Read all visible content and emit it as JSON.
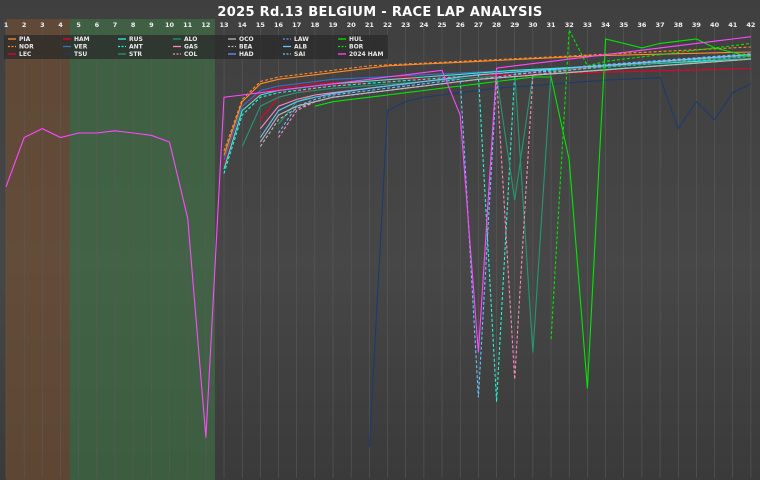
{
  "chart_data": {
    "type": "line",
    "title": "2025 Rd.13 BELGIUM - RACE LAP ANALYSIS",
    "xlabel": "",
    "ylabel": "",
    "x": [
      1,
      2,
      3,
      4,
      5,
      6,
      7,
      8,
      9,
      10,
      11,
      12,
      13,
      14,
      15,
      16,
      17,
      18,
      19,
      20,
      21,
      22,
      23,
      24,
      25,
      26,
      27,
      28,
      29,
      30,
      31,
      32,
      33,
      34,
      35,
      36,
      37,
      38,
      39,
      40,
      41,
      42
    ],
    "xlim": [
      1,
      42.5
    ],
    "ylim": [
      0,
      100
    ],
    "grid": true,
    "legend_position": "top-left",
    "shaded_regions": [
      {
        "from": 1,
        "to": 4.5,
        "color": "#7a5030"
      },
      {
        "from": 4.5,
        "to": 12.5,
        "color": "#3e7a45"
      }
    ],
    "series": [
      {
        "name": "PIA",
        "color": "#ff8a2a",
        "dash": false,
        "values": [
          null,
          null,
          null,
          null,
          null,
          null,
          null,
          null,
          null,
          null,
          null,
          null,
          72,
          84,
          88,
          89,
          89.5,
          90,
          90.5,
          91,
          91.5,
          92,
          92.2,
          92.4,
          92.6,
          92.8,
          93,
          93.2,
          93.4,
          93.6,
          93.8,
          94,
          94.2,
          94.3,
          94.4,
          94.5,
          94.6,
          94.7,
          94.8,
          94.9,
          95,
          95.1
        ]
      },
      {
        "name": "NOR",
        "color": "#ff8a2a",
        "dash": true,
        "values": [
          null,
          null,
          null,
          null,
          null,
          null,
          null,
          null,
          null,
          null,
          null,
          null,
          73,
          84.5,
          88.5,
          89.5,
          90,
          90.5,
          91,
          91.5,
          92,
          92.2,
          92.4,
          92.6,
          92.8,
          93,
          93.2,
          93.4,
          93.6,
          93.8,
          94,
          94.2,
          94.4,
          94.6,
          94.8,
          95,
          95.2,
          95.4,
          95.6,
          95.8,
          96,
          96.2
        ]
      },
      {
        "name": "LEC",
        "color": "#e8002d",
        "dash": false,
        "values": [
          null,
          null,
          null,
          null,
          null,
          null,
          null,
          null,
          null,
          null,
          null,
          null,
          70,
          82,
          86,
          87,
          87.5,
          88,
          88.2,
          88.4,
          88.6,
          88.8,
          89,
          89.2,
          89.4,
          89.6,
          89.8,
          90,
          90.1,
          90.2,
          90.3,
          90.4,
          90.5,
          90.6,
          90.7,
          90.8,
          90.9,
          91,
          91.1,
          91.2,
          91.3,
          91.4
        ]
      },
      {
        "name": "HAM",
        "color": "#e8002d",
        "dash": false,
        "values": [
          null,
          null,
          null,
          null,
          null,
          null,
          null,
          null,
          null,
          null,
          null,
          null,
          null,
          null,
          80,
          85,
          86,
          87,
          87.5,
          88,
          88.5,
          89,
          89.5,
          90,
          90.2,
          90.4,
          90.6,
          90.8,
          91,
          91.2,
          91.4,
          91.6,
          91.8,
          92,
          92.2,
          92.4,
          92.6,
          92.8,
          93,
          93.2,
          93.4,
          93.6
        ]
      },
      {
        "name": "VER",
        "color": "#3671c6",
        "dash": false,
        "values": [
          null,
          null,
          null,
          null,
          null,
          null,
          null,
          null,
          null,
          null,
          null,
          null,
          71,
          83,
          86.5,
          87.5,
          88,
          88.5,
          89,
          89.2,
          89.4,
          89.6,
          89.8,
          90,
          90.2,
          90.4,
          90.6,
          90.8,
          91,
          91.2,
          91.4,
          91.6,
          91.8,
          92,
          92.2,
          92.4,
          92.6,
          92.8,
          93,
          93.2,
          93.4,
          93.6
        ]
      },
      {
        "name": "TSU",
        "color": "#1b3b70",
        "dash": false,
        "values": [
          null,
          null,
          null,
          null,
          null,
          null,
          null,
          null,
          null,
          null,
          null,
          null,
          null,
          null,
          null,
          null,
          null,
          null,
          null,
          null,
          7,
          82,
          84,
          85,
          85.5,
          86,
          86.5,
          87,
          87.3,
          87.6,
          87.9,
          88.2,
          88.5,
          88.8,
          89,
          89.2,
          89.4,
          78,
          84,
          80,
          86,
          88
        ]
      },
      {
        "name": "RUS",
        "color": "#27f4d2",
        "dash": false,
        "values": [
          null,
          null,
          null,
          null,
          null,
          null,
          null,
          null,
          null,
          null,
          null,
          null,
          69,
          82,
          85.5,
          86.5,
          87,
          87.5,
          88,
          88.3,
          88.6,
          88.9,
          89.2,
          89.5,
          89.8,
          90.1,
          90.4,
          90.7,
          91,
          91.2,
          91.4,
          91.6,
          91.8,
          92,
          92.2,
          92.4,
          92.6,
          92.8,
          93,
          93.2,
          93.4,
          93.6
        ]
      },
      {
        "name": "ANT",
        "color": "#27f4d2",
        "dash": true,
        "values": [
          null,
          null,
          null,
          null,
          null,
          null,
          null,
          null,
          null,
          null,
          null,
          null,
          68,
          81,
          85,
          86,
          86.5,
          87,
          87.5,
          87.8,
          88.1,
          88.4,
          88.7,
          89,
          89.3,
          89.6,
          89.9,
          17,
          90.2,
          90.5,
          90.8,
          91.1,
          91.4,
          91.7,
          92,
          92.3,
          92.6,
          92.9,
          93.2,
          93.5,
          93.8,
          94.1
        ]
      },
      {
        "name": "STR",
        "color": "#229971",
        "dash": false,
        "values": [
          null,
          null,
          null,
          null,
          null,
          null,
          null,
          null,
          null,
          null,
          null,
          null,
          null,
          74,
          83,
          85,
          86,
          86.5,
          87,
          87.3,
          87.6,
          87.9,
          88.2,
          88.5,
          88.8,
          89.1,
          89.4,
          89.7,
          62,
          90,
          90.3,
          90.6,
          90.9,
          91.2,
          91.5,
          91.8,
          92.1,
          92.4,
          92.7,
          93,
          93.3,
          93.6
        ]
      },
      {
        "name": "ALO",
        "color": "#229971",
        "dash": false,
        "values": [
          null,
          null,
          null,
          null,
          null,
          null,
          null,
          null,
          null,
          null,
          null,
          null,
          null,
          null,
          null,
          79,
          84,
          85.5,
          86,
          86.5,
          87,
          87.5,
          88,
          88.5,
          89,
          89.5,
          90,
          90.3,
          90.6,
          28,
          90.9,
          91.2,
          91.5,
          91.8,
          92.1,
          92.4,
          92.7,
          93,
          93.3,
          93.6,
          93.9,
          94.2
        ]
      },
      {
        "name": "GAS",
        "color": "#ff87bc",
        "dash": false,
        "values": [
          null,
          null,
          null,
          null,
          null,
          null,
          null,
          null,
          null,
          null,
          null,
          null,
          null,
          null,
          78,
          83,
          84.5,
          85.5,
          86,
          86.5,
          87,
          87.5,
          88,
          88.5,
          89,
          89.5,
          90,
          90.3,
          90.6,
          90.9,
          91.2,
          91.5,
          91.8,
          92.1,
          92.4,
          92.7,
          93,
          93.3,
          93.6,
          93.9,
          94.2,
          94.5
        ]
      },
      {
        "name": "COL",
        "color": "#ff87bc",
        "dash": true,
        "values": [
          null,
          null,
          null,
          null,
          null,
          null,
          null,
          null,
          null,
          null,
          null,
          null,
          null,
          null,
          null,
          76,
          82,
          84,
          85,
          85.5,
          86,
          86.5,
          87,
          87.5,
          88,
          88.5,
          89,
          89.5,
          22,
          90,
          90.5,
          91,
          91.5,
          92,
          92.3,
          92.6,
          92.9,
          93.2,
          93.5,
          93.8,
          94.1,
          94.4
        ]
      },
      {
        "name": "OCO",
        "color": "#b6babd",
        "dash": false,
        "values": [
          null,
          null,
          null,
          null,
          null,
          null,
          null,
          null,
          null,
          null,
          null,
          null,
          null,
          null,
          75,
          81,
          83,
          84,
          85,
          85.5,
          86,
          86.5,
          87,
          87.5,
          88,
          88.5,
          89,
          89.3,
          89.6,
          89.9,
          90.2,
          90.5,
          90.8,
          91.1,
          91.4,
          91.7,
          92,
          92.3,
          92.6,
          92.9,
          93.2,
          93.5
        ]
      },
      {
        "name": "BEA",
        "color": "#b6babd",
        "dash": true,
        "values": [
          null,
          null,
          null,
          null,
          null,
          null,
          null,
          null,
          null,
          null,
          null,
          null,
          null,
          null,
          74,
          80,
          82.5,
          84,
          85,
          85.5,
          86,
          86.5,
          87,
          87.5,
          88,
          88.5,
          89,
          89.3,
          89.6,
          89.9,
          90.2,
          90.5,
          90.8,
          91.1,
          91.4,
          91.7,
          92,
          92.3,
          92.6,
          92.9,
          93.2,
          93.5
        ]
      },
      {
        "name": "HAD",
        "color": "#6692ff",
        "dash": false,
        "values": [
          null,
          null,
          null,
          null,
          null,
          null,
          null,
          null,
          null,
          null,
          null,
          null,
          null,
          null,
          null,
          null,
          null,
          null,
          null,
          null,
          null,
          null,
          null,
          null,
          null,
          null,
          null,
          null,
          null,
          null,
          null,
          null,
          null,
          null,
          null,
          null,
          null,
          null,
          null,
          null,
          null,
          null
        ]
      },
      {
        "name": "LAW",
        "color": "#6692ff",
        "dash": true,
        "values": [
          null,
          null,
          null,
          null,
          null,
          null,
          null,
          null,
          null,
          null,
          null,
          null,
          null,
          null,
          null,
          null,
          null,
          null,
          null,
          null,
          null,
          null,
          null,
          null,
          null,
          null,
          null,
          null,
          null,
          null,
          null,
          null,
          null,
          null,
          null,
          null,
          null,
          null,
          null,
          null,
          null,
          null
        ]
      },
      {
        "name": "ALB",
        "color": "#64c4ff",
        "dash": false,
        "values": [
          null,
          null,
          null,
          null,
          null,
          null,
          null,
          null,
          null,
          null,
          null,
          null,
          null,
          null,
          76,
          82,
          84,
          85,
          85.8,
          86.4,
          87,
          87.5,
          88,
          88.5,
          89,
          89.5,
          90,
          90.3,
          90.6,
          90.9,
          91.2,
          91.5,
          91.8,
          92.1,
          92.4,
          92.7,
          93,
          93.3,
          93.6,
          93.9,
          94.2,
          94.5
        ]
      },
      {
        "name": "SAI",
        "color": "#64c4ff",
        "dash": true,
        "values": [
          null,
          null,
          null,
          null,
          null,
          null,
          null,
          null,
          null,
          null,
          null,
          null,
          null,
          null,
          null,
          77,
          83,
          84.5,
          85.5,
          86,
          86.5,
          87,
          87.5,
          88,
          88.5,
          89,
          18,
          89.5,
          90,
          90.5,
          91,
          91.5,
          92,
          92.3,
          92.6,
          92.9,
          93.2,
          93.5,
          93.8,
          94.1,
          94.4,
          94.7
        ]
      },
      {
        "name": "HUL",
        "color": "#00e701",
        "dash": false,
        "values": [
          null,
          null,
          null,
          null,
          null,
          null,
          null,
          null,
          null,
          null,
          null,
          null,
          null,
          null,
          null,
          null,
          null,
          83,
          84,
          84.5,
          85,
          85.5,
          86,
          86.5,
          87,
          87.5,
          88,
          88.5,
          89,
          89.5,
          89.5,
          71,
          20,
          98,
          97,
          96,
          97,
          97.5,
          98,
          96,
          95,
          94
        ]
      },
      {
        "name": "BOR",
        "color": "#00e701",
        "dash": true,
        "values": [
          null,
          null,
          null,
          null,
          null,
          null,
          null,
          null,
          null,
          null,
          null,
          null,
          null,
          null,
          null,
          null,
          null,
          null,
          null,
          null,
          null,
          null,
          null,
          null,
          null,
          null,
          null,
          null,
          null,
          null,
          31,
          100,
          92,
          93,
          93.5,
          94,
          94.5,
          95,
          95.5,
          96,
          96.5,
          97
        ]
      },
      {
        "name": "2024 HAM",
        "color": "#ff48ff",
        "dash": false,
        "values": [
          65,
          76,
          78,
          76,
          77,
          77,
          77.5,
          77,
          76.5,
          75,
          58,
          9,
          85,
          85.5,
          86,
          86.5,
          87,
          87.5,
          88,
          88.5,
          89,
          89.5,
          90,
          90.5,
          91,
          81,
          28,
          91.5,
          92,
          92.5,
          93,
          93.5,
          94,
          94.5,
          95,
          95.5,
          96,
          96.5,
          97,
          97.5,
          98,
          98.5
        ]
      }
    ]
  }
}
